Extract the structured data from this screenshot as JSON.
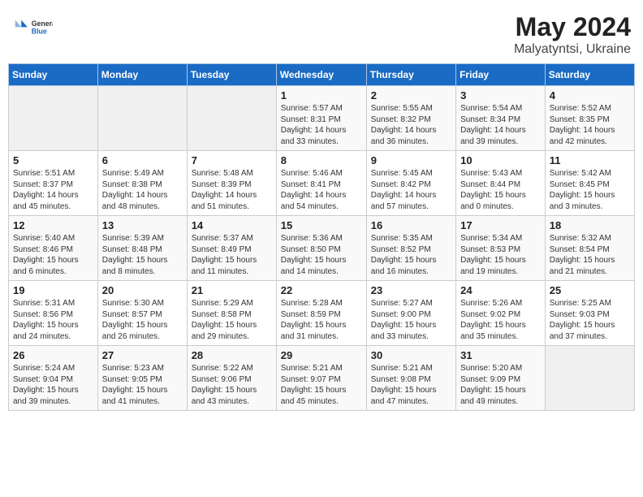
{
  "header": {
    "logo_general": "General",
    "logo_blue": "Blue",
    "title": "May 2024",
    "location": "Malyatyntsi, Ukraine"
  },
  "weekdays": [
    "Sunday",
    "Monday",
    "Tuesday",
    "Wednesday",
    "Thursday",
    "Friday",
    "Saturday"
  ],
  "weeks": [
    [
      {
        "day": "",
        "info": ""
      },
      {
        "day": "",
        "info": ""
      },
      {
        "day": "",
        "info": ""
      },
      {
        "day": "1",
        "info": "Sunrise: 5:57 AM\nSunset: 8:31 PM\nDaylight: 14 hours\nand 33 minutes."
      },
      {
        "day": "2",
        "info": "Sunrise: 5:55 AM\nSunset: 8:32 PM\nDaylight: 14 hours\nand 36 minutes."
      },
      {
        "day": "3",
        "info": "Sunrise: 5:54 AM\nSunset: 8:34 PM\nDaylight: 14 hours\nand 39 minutes."
      },
      {
        "day": "4",
        "info": "Sunrise: 5:52 AM\nSunset: 8:35 PM\nDaylight: 14 hours\nand 42 minutes."
      }
    ],
    [
      {
        "day": "5",
        "info": "Sunrise: 5:51 AM\nSunset: 8:37 PM\nDaylight: 14 hours\nand 45 minutes."
      },
      {
        "day": "6",
        "info": "Sunrise: 5:49 AM\nSunset: 8:38 PM\nDaylight: 14 hours\nand 48 minutes."
      },
      {
        "day": "7",
        "info": "Sunrise: 5:48 AM\nSunset: 8:39 PM\nDaylight: 14 hours\nand 51 minutes."
      },
      {
        "day": "8",
        "info": "Sunrise: 5:46 AM\nSunset: 8:41 PM\nDaylight: 14 hours\nand 54 minutes."
      },
      {
        "day": "9",
        "info": "Sunrise: 5:45 AM\nSunset: 8:42 PM\nDaylight: 14 hours\nand 57 minutes."
      },
      {
        "day": "10",
        "info": "Sunrise: 5:43 AM\nSunset: 8:44 PM\nDaylight: 15 hours\nand 0 minutes."
      },
      {
        "day": "11",
        "info": "Sunrise: 5:42 AM\nSunset: 8:45 PM\nDaylight: 15 hours\nand 3 minutes."
      }
    ],
    [
      {
        "day": "12",
        "info": "Sunrise: 5:40 AM\nSunset: 8:46 PM\nDaylight: 15 hours\nand 6 minutes."
      },
      {
        "day": "13",
        "info": "Sunrise: 5:39 AM\nSunset: 8:48 PM\nDaylight: 15 hours\nand 8 minutes."
      },
      {
        "day": "14",
        "info": "Sunrise: 5:37 AM\nSunset: 8:49 PM\nDaylight: 15 hours\nand 11 minutes."
      },
      {
        "day": "15",
        "info": "Sunrise: 5:36 AM\nSunset: 8:50 PM\nDaylight: 15 hours\nand 14 minutes."
      },
      {
        "day": "16",
        "info": "Sunrise: 5:35 AM\nSunset: 8:52 PM\nDaylight: 15 hours\nand 16 minutes."
      },
      {
        "day": "17",
        "info": "Sunrise: 5:34 AM\nSunset: 8:53 PM\nDaylight: 15 hours\nand 19 minutes."
      },
      {
        "day": "18",
        "info": "Sunrise: 5:32 AM\nSunset: 8:54 PM\nDaylight: 15 hours\nand 21 minutes."
      }
    ],
    [
      {
        "day": "19",
        "info": "Sunrise: 5:31 AM\nSunset: 8:56 PM\nDaylight: 15 hours\nand 24 minutes."
      },
      {
        "day": "20",
        "info": "Sunrise: 5:30 AM\nSunset: 8:57 PM\nDaylight: 15 hours\nand 26 minutes."
      },
      {
        "day": "21",
        "info": "Sunrise: 5:29 AM\nSunset: 8:58 PM\nDaylight: 15 hours\nand 29 minutes."
      },
      {
        "day": "22",
        "info": "Sunrise: 5:28 AM\nSunset: 8:59 PM\nDaylight: 15 hours\nand 31 minutes."
      },
      {
        "day": "23",
        "info": "Sunrise: 5:27 AM\nSunset: 9:00 PM\nDaylight: 15 hours\nand 33 minutes."
      },
      {
        "day": "24",
        "info": "Sunrise: 5:26 AM\nSunset: 9:02 PM\nDaylight: 15 hours\nand 35 minutes."
      },
      {
        "day": "25",
        "info": "Sunrise: 5:25 AM\nSunset: 9:03 PM\nDaylight: 15 hours\nand 37 minutes."
      }
    ],
    [
      {
        "day": "26",
        "info": "Sunrise: 5:24 AM\nSunset: 9:04 PM\nDaylight: 15 hours\nand 39 minutes."
      },
      {
        "day": "27",
        "info": "Sunrise: 5:23 AM\nSunset: 9:05 PM\nDaylight: 15 hours\nand 41 minutes."
      },
      {
        "day": "28",
        "info": "Sunrise: 5:22 AM\nSunset: 9:06 PM\nDaylight: 15 hours\nand 43 minutes."
      },
      {
        "day": "29",
        "info": "Sunrise: 5:21 AM\nSunset: 9:07 PM\nDaylight: 15 hours\nand 45 minutes."
      },
      {
        "day": "30",
        "info": "Sunrise: 5:21 AM\nSunset: 9:08 PM\nDaylight: 15 hours\nand 47 minutes."
      },
      {
        "day": "31",
        "info": "Sunrise: 5:20 AM\nSunset: 9:09 PM\nDaylight: 15 hours\nand 49 minutes."
      },
      {
        "day": "",
        "info": ""
      }
    ]
  ]
}
